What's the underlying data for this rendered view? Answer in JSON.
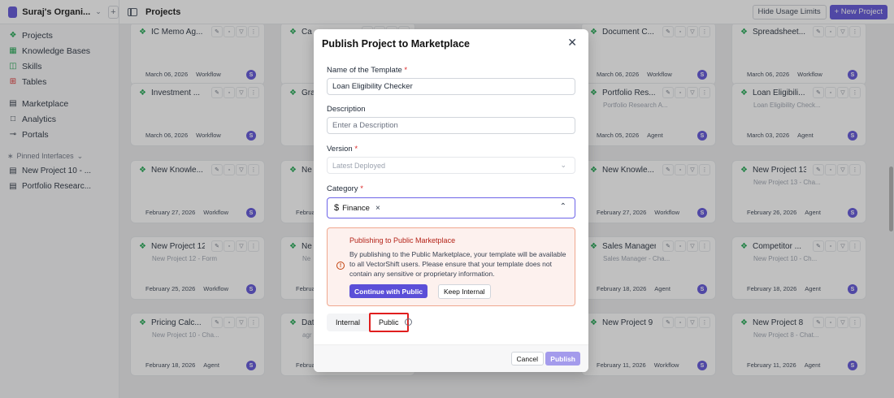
{
  "org": {
    "name": "Suraj's Organi...",
    "logo_color": "#5b4fd8"
  },
  "header": {
    "title": "Projects",
    "hide_usage_label": "Hide Usage Limits",
    "new_project_label": "+ New Project"
  },
  "sidebar": {
    "items": [
      {
        "label": "Projects",
        "icon": "cube-icon"
      },
      {
        "label": "Knowledge Bases",
        "icon": "database-icon"
      },
      {
        "label": "Skills",
        "icon": "book-icon"
      },
      {
        "label": "Tables",
        "icon": "table-icon"
      },
      {
        "label": "Marketplace",
        "icon": "store-icon"
      },
      {
        "label": "Analytics",
        "icon": "chart-icon"
      },
      {
        "label": "Portals",
        "icon": "key-icon"
      }
    ],
    "pinned_label": "Pinned Interfaces",
    "pinned": [
      {
        "label": "New Project 10 - ..."
      },
      {
        "label": "Portfolio Researc..."
      }
    ]
  },
  "cards": [
    {
      "col": 0,
      "row": 0,
      "title": "IC Memo Ag...",
      "sub": "",
      "date": "March 06, 2026",
      "type": "Workflow"
    },
    {
      "col": 1,
      "row": 0,
      "title": "Ca",
      "sub": "",
      "date": "",
      "type": ""
    },
    {
      "col": 3,
      "row": 0,
      "title": "Document C...",
      "sub": "",
      "date": "March 06, 2026",
      "type": "Workflow"
    },
    {
      "col": 4,
      "row": 0,
      "title": "Spreadsheet...",
      "sub": "",
      "date": "March 06, 2026",
      "type": "Workflow"
    },
    {
      "col": 0,
      "row": 1,
      "title": "Investment ...",
      "sub": "",
      "date": "March 06, 2026",
      "type": "Workflow"
    },
    {
      "col": 1,
      "row": 1,
      "title": "Gra",
      "sub": "",
      "date": "",
      "type": ""
    },
    {
      "col": 3,
      "row": 1,
      "title": "Portfolio Res...",
      "sub": "Portfolio Research A...",
      "date": "March 05, 2026",
      "type": "Agent"
    },
    {
      "col": 4,
      "row": 1,
      "title": "Loan Eligibili...",
      "sub": "Loan Eligibility Check...",
      "date": "March 03, 2026",
      "type": "Agent"
    },
    {
      "col": 0,
      "row": 2,
      "title": "New Knowle...",
      "sub": "",
      "date": "February 27, 2026",
      "type": "Workflow"
    },
    {
      "col": 1,
      "row": 2,
      "title": "Ne",
      "sub": "",
      "date": "Februar",
      "type": ""
    },
    {
      "col": 3,
      "row": 2,
      "title": "New Knowle...",
      "sub": "",
      "date": "February 27, 2026",
      "type": "Workflow"
    },
    {
      "col": 4,
      "row": 2,
      "title": "New Project 13",
      "sub": "New Project 13 - Cha...",
      "date": "February 26, 2026",
      "type": "Agent"
    },
    {
      "col": 0,
      "row": 3,
      "title": "New Project 12",
      "sub": "New Project 12 - Form",
      "date": "February 25, 2026",
      "type": "Workflow"
    },
    {
      "col": 1,
      "row": 3,
      "title": "Ne",
      "sub": "Ne",
      "date": "Februar",
      "type": ""
    },
    {
      "col": 3,
      "row": 3,
      "title": "Sales Manager",
      "sub": "Sales Manager - Cha...",
      "date": "February 18, 2026",
      "type": "Agent"
    },
    {
      "col": 4,
      "row": 3,
      "title": "Competitor ...",
      "sub": "New Project 10 - Ch...",
      "date": "February 18, 2026",
      "type": "Agent"
    },
    {
      "col": 0,
      "row": 4,
      "title": "Pricing Calc...",
      "sub": "New Project 10 - Cha...",
      "date": "February 18, 2026",
      "type": "Agent"
    },
    {
      "col": 1,
      "row": 4,
      "title": "Dat",
      "sub": "agr",
      "date": "Februar",
      "type": ""
    },
    {
      "col": 3,
      "row": 4,
      "title": "New Project 9",
      "sub": "",
      "date": "February 11, 2026",
      "type": "Workflow"
    },
    {
      "col": 4,
      "row": 4,
      "title": "New Project 8",
      "sub": "New Project 8 - Chat...",
      "date": "February 11, 2026",
      "type": "Agent"
    }
  ],
  "modal": {
    "title": "Publish Project to Marketplace",
    "name_label": "Name of the Template",
    "name_value": "Loan Eligibility Checker",
    "description_label": "Description",
    "description_placeholder": "Enter a Description",
    "version_label": "Version",
    "version_value": "Latest Deployed",
    "category_label": "Category",
    "category_value": "Finance",
    "warning_title": "Publishing to Public Marketplace",
    "warning_text": "By publishing to the Public Marketplace, your template will be available to all VectorShift users. Please ensure that your template does not contain any sensitive or proprietary information.",
    "continue_label": "Continue with Public",
    "keep_label": "Keep Internal",
    "internal_label": "Internal",
    "public_label": "Public",
    "cancel_label": "Cancel",
    "publish_label": "Publish"
  },
  "colors": {
    "accent": "#5b4fd8",
    "warning_bg": "#fdf1ee",
    "warning_border": "#f0a88f",
    "highlight": "#e01e1e"
  }
}
